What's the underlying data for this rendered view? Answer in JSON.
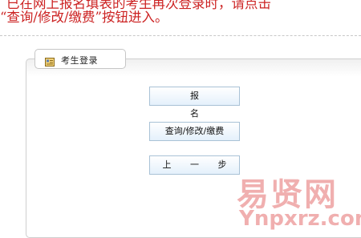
{
  "notice": {
    "line1": "已在网上报名填表的考生再次登录时，请点击",
    "line2": "“查询/修改/缴费”按钮进入。"
  },
  "panel": {
    "title": "考生登录",
    "icon": "login-card-icon"
  },
  "buttons": {
    "register": "报 名",
    "query": "查询/修改/缴费",
    "back": "上 一 步"
  },
  "watermark": {
    "cn": "易贤网",
    "en": "Ynpxrz.com"
  },
  "colors": {
    "notice_text": "#cc2222",
    "button_border": "#a9c2d6",
    "watermark": "#e46f6f"
  }
}
